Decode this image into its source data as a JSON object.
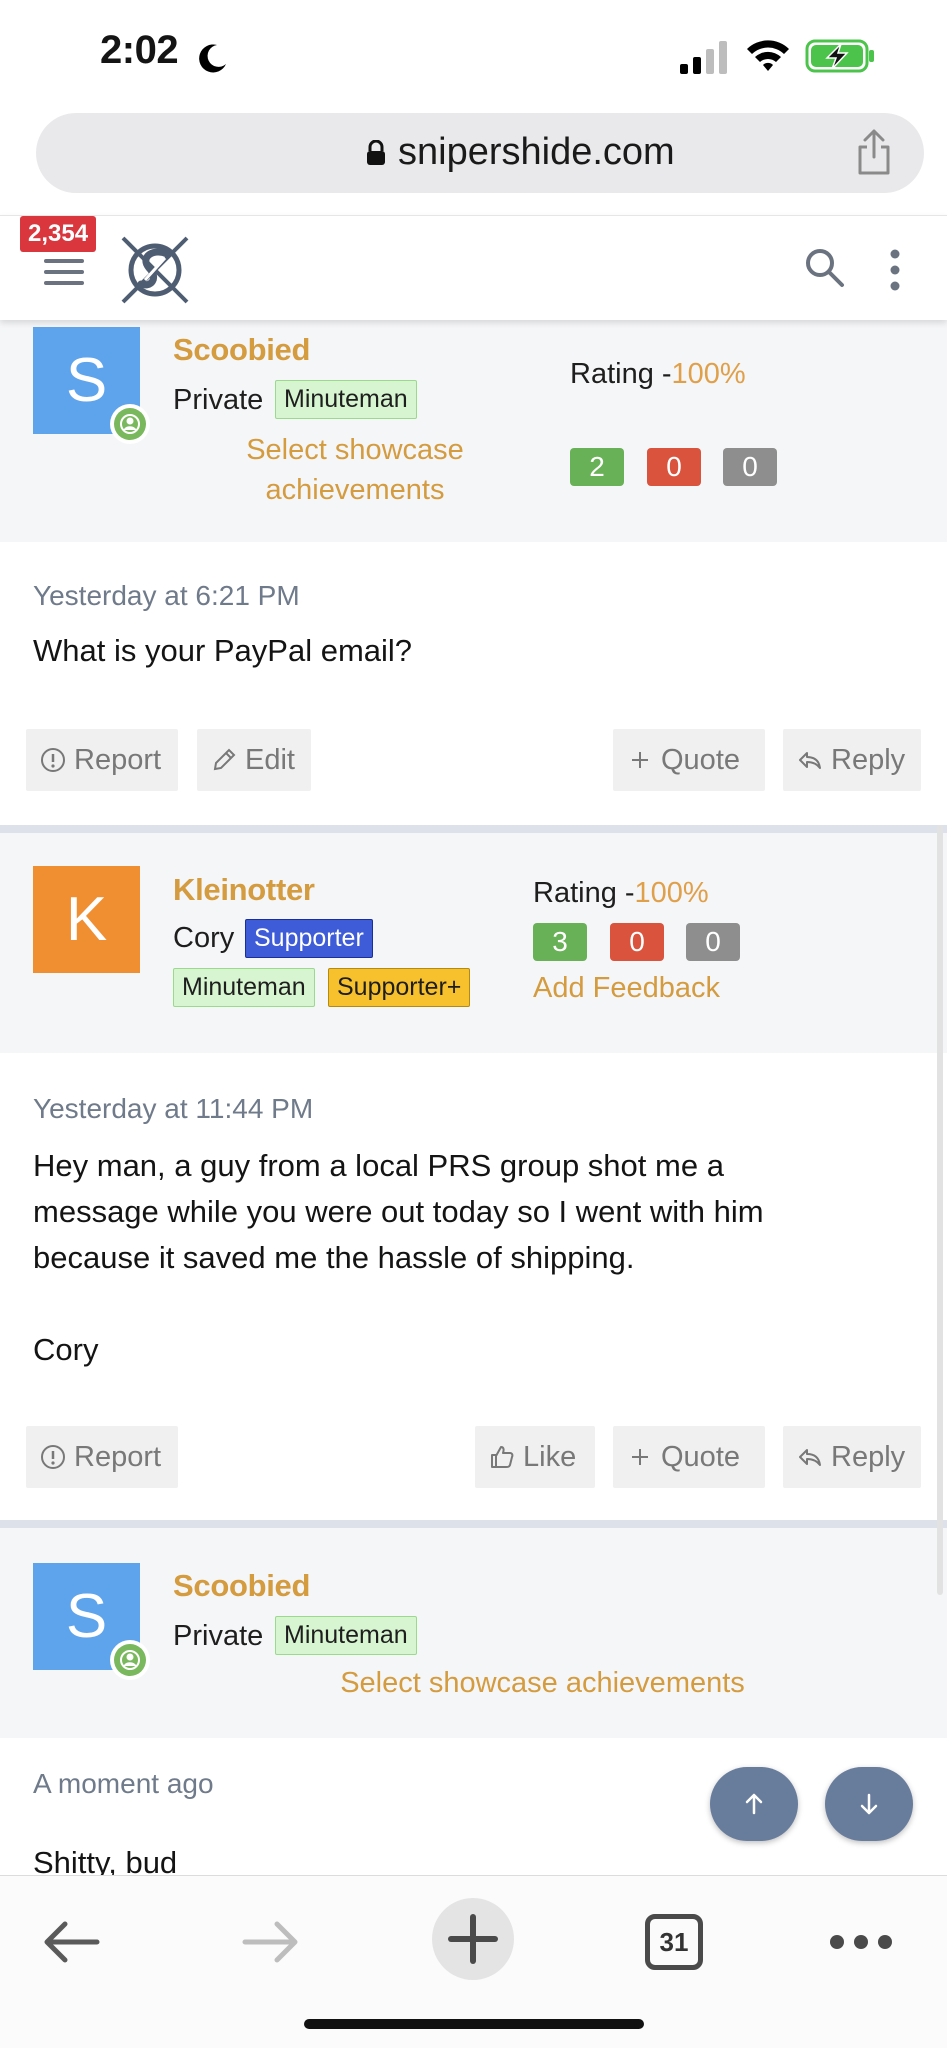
{
  "status": {
    "time": "2:02"
  },
  "browser": {
    "url": "snipershide.com",
    "tab_count": "31"
  },
  "header": {
    "notification_count": "2,354"
  },
  "posts": [
    {
      "user": {
        "initial": "S",
        "name": "Scoobied",
        "rank": "Private",
        "tags": [
          "Minuteman"
        ],
        "showcase_line1": "Select showcase",
        "showcase_line2": "achievements"
      },
      "rating_label": "Rating -",
      "rating_pct": "100%",
      "feedback": [
        "2",
        "0",
        "0"
      ],
      "time": "Yesterday at 6:21 PM",
      "text": "What is your PayPal email?",
      "actions": {
        "report": "Report",
        "edit": "Edit",
        "quote": "Quote",
        "reply": "Reply"
      }
    },
    {
      "user": {
        "initial": "K",
        "name": "Kleinotter",
        "rank": "Cory",
        "tags": [
          "Supporter",
          "Minuteman",
          "Supporter+"
        ]
      },
      "rating_label": "Rating -",
      "rating_pct": "100%",
      "feedback": [
        "3",
        "0",
        "0"
      ],
      "add_feedback": "Add Feedback",
      "time": "Yesterday at 11:44 PM",
      "text": "Hey man, a guy from a local PRS group shot me a\nmessage while you were out today so I went with him\nbecause it saved me the hassle of shipping.\n\nCory",
      "actions": {
        "report": "Report",
        "like": "Like",
        "quote": "Quote",
        "reply": "Reply"
      }
    },
    {
      "user": {
        "initial": "S",
        "name": "Scoobied",
        "rank": "Private",
        "tags": [
          "Minuteman"
        ],
        "showcase": "Select showcase achievements"
      },
      "time": "A moment ago",
      "text": "Shitty, bud"
    }
  ],
  "colors": {
    "accent": "#d49b3f",
    "fab": "#687c9c",
    "rating_green": "#68b156",
    "rating_red": "#d9533d",
    "rating_grey": "#8e8e8e"
  }
}
